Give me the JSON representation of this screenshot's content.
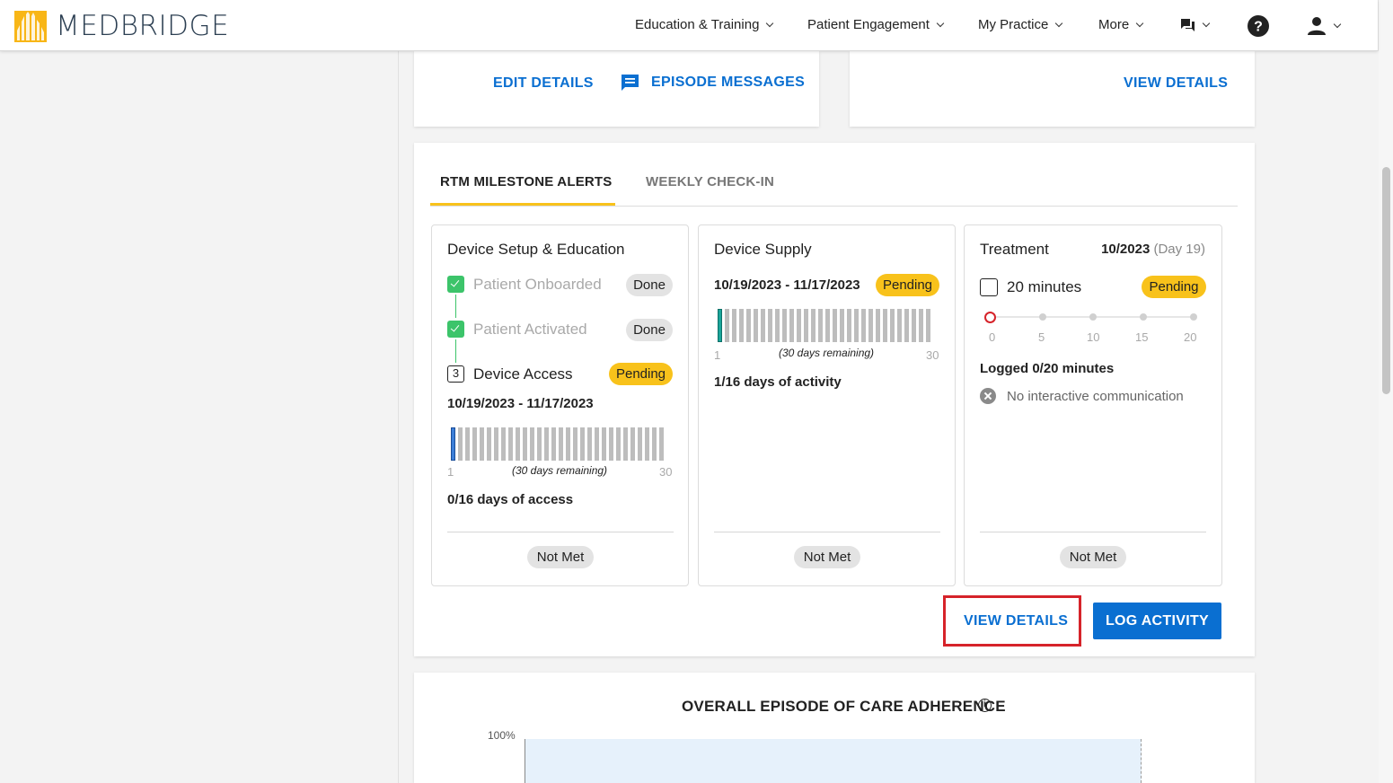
{
  "brand": {
    "name": "MEDBRIDGE",
    "accent": "#f8b617"
  },
  "nav": {
    "items": [
      "Education & Training",
      "Patient Engagement",
      "My Practice",
      "More"
    ],
    "icons": [
      "chat-icon",
      "help-icon",
      "user-icon"
    ]
  },
  "top_cards": {
    "left": {
      "edit_details": "EDIT DETAILS",
      "episode_messages": "EPISODE MESSAGES"
    },
    "right": {
      "view_details": "VIEW DETAILS"
    }
  },
  "rtm": {
    "tabs": [
      "RTM MILESTONE ALERTS",
      "WEEKLY CHECK-IN"
    ],
    "active_tab": 0,
    "cards": {
      "device_setup": {
        "title": "Device Setup & Education",
        "steps": [
          {
            "label": "Patient Onboarded",
            "status": "Done"
          },
          {
            "label": "Patient Activated",
            "status": "Done"
          },
          {
            "number": "3",
            "label": "Device Access",
            "status": "Pending"
          }
        ],
        "date_range": "10/19/2023 - 11/17/2023",
        "bar_start": "1",
        "bar_end": "30",
        "remaining": "(30 days remaining)",
        "summary": "0/16 days of access",
        "result": "Not Met"
      },
      "device_supply": {
        "title": "Device Supply",
        "date_range": "10/19/2023 - 11/17/2023",
        "status": "Pending",
        "bar_start": "1",
        "bar_end": "30",
        "remaining": "(30 days remaining)",
        "summary": "1/16 days of activity",
        "result": "Not Met"
      },
      "treatment": {
        "title": "Treatment",
        "month": "10/2023",
        "day": "(Day 19)",
        "checkbox_label": "20 minutes",
        "status": "Pending",
        "ticks": [
          "0",
          "5",
          "10",
          "15",
          "20"
        ],
        "logged": "Logged 0/20 minutes",
        "note": "No interactive communication",
        "result": "Not Met"
      }
    },
    "buttons": {
      "view_details": "VIEW DETAILS",
      "log_activity": "LOG ACTIVITY"
    }
  },
  "adherence": {
    "title": "OVERALL EPISODE OF CARE ADHERENCE",
    "y_tick": "100%"
  }
}
